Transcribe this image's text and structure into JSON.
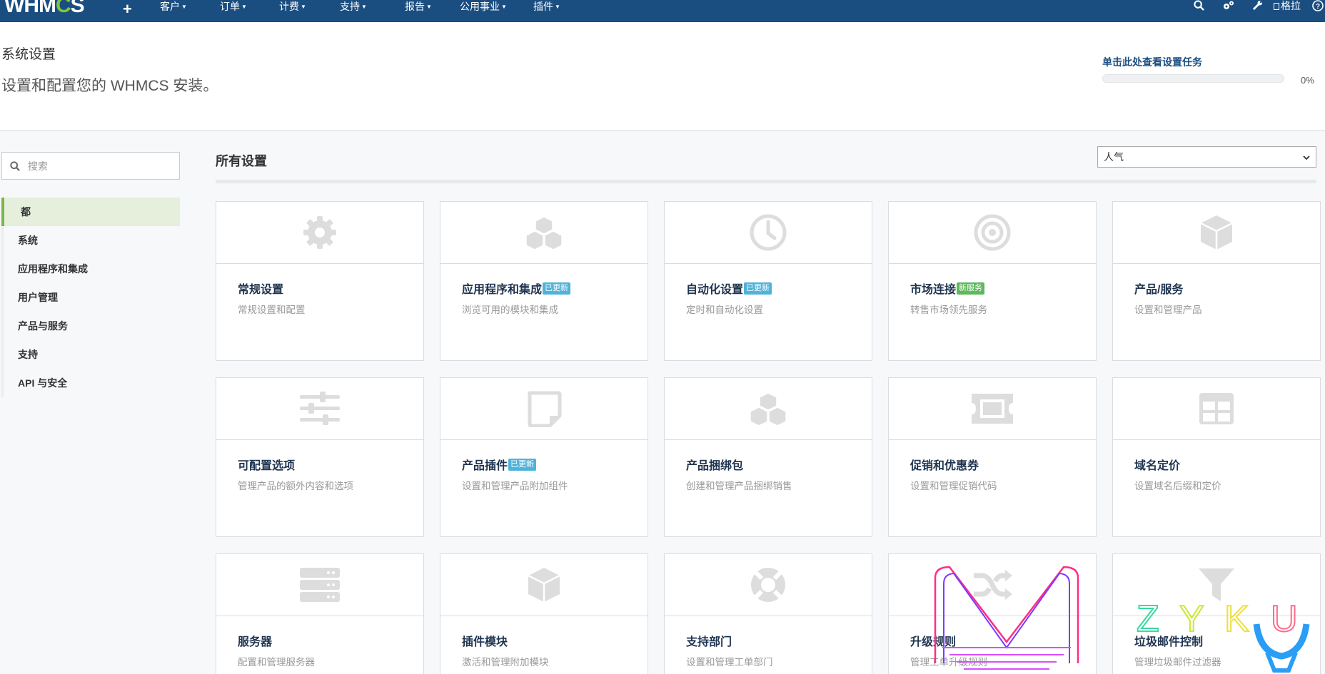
{
  "nav": {
    "logo_pre": "WHM",
    "logo_o": "C",
    "logo_post": "S",
    "plus": "+",
    "items": [
      "客户",
      "订单",
      "计费",
      "支持",
      "报告",
      "公用事业",
      "插件"
    ],
    "user": "格拉"
  },
  "header": {
    "title": "系统设置",
    "subtitle": "设置和配置您的 WHMCS 安装。",
    "setup_link": "单击此处查看设置任务",
    "progress_percent": 0,
    "progress_text": "0%"
  },
  "sidebar": {
    "search_placeholder": "搜索",
    "items": [
      "都",
      "系统",
      "应用程序和集成",
      "用户管理",
      "产品与服务",
      "支持",
      "API 与安全"
    ],
    "active_index": 0
  },
  "main": {
    "title": "所有设置",
    "sort_value": "人气",
    "cards": [
      {
        "title": "常规设置",
        "desc": "常规设置和配置",
        "badge": "",
        "icon": "gear-icon"
      },
      {
        "title": "应用程序和集成",
        "desc": "浏览可用的模块和集成",
        "badge": "已更新",
        "badge_color": "blue",
        "icon": "cubes-icon"
      },
      {
        "title": "自动化设置",
        "desc": "定时和自动化设置",
        "badge": "已更新",
        "badge_color": "blue",
        "icon": "clock-icon"
      },
      {
        "title": "市场连接",
        "desc": "转售市场领先服务",
        "badge": "新服务",
        "badge_color": "green",
        "icon": "target-icon"
      },
      {
        "title": "产品/服务",
        "desc": "设置和管理产品",
        "badge": "",
        "icon": "cube-icon"
      },
      {
        "title": "可配置选项",
        "desc": "管理产品的额外内容和选项",
        "badge": "",
        "icon": "sliders-icon"
      },
      {
        "title": "产品插件",
        "desc": "设置和管理产品附加组件",
        "badge": "已更新",
        "badge_color": "blue",
        "icon": "sticky-note-icon"
      },
      {
        "title": "产品捆绑包",
        "desc": "创建和管理产品捆绑销售",
        "badge": "",
        "icon": "cubes-icon"
      },
      {
        "title": "促销和优惠券",
        "desc": "设置和管理促销代码",
        "badge": "",
        "icon": "ticket-icon"
      },
      {
        "title": "域名定价",
        "desc": "设置域名后缀和定价",
        "badge": "",
        "icon": "table-icon"
      },
      {
        "title": "服务器",
        "desc": "配置和管理服务器",
        "badge": "",
        "icon": "server-icon"
      },
      {
        "title": "插件模块",
        "desc": "激活和管理附加模块",
        "badge": "",
        "icon": "cube-icon"
      },
      {
        "title": "支持部门",
        "desc": "设置和管理工单部门",
        "badge": "",
        "icon": "life-ring-icon"
      },
      {
        "title": "升级规则",
        "desc": "管理工单升级规则",
        "badge": "",
        "icon": "random-icon"
      },
      {
        "title": "垃圾邮件控制",
        "desc": "管理垃圾邮件过滤器",
        "badge": "",
        "icon": "filter-icon"
      }
    ]
  },
  "watermark": {
    "text_m": "M",
    "text_zyku": "Z Y K U"
  },
  "colors": {
    "nav_bg": "#1a4d80",
    "accent_green": "#7ab648",
    "icon_gray": "#dddddd",
    "title_dark": "#1f3450",
    "badge_blue": "#4fb3d9",
    "badge_green": "#5cb85c"
  }
}
